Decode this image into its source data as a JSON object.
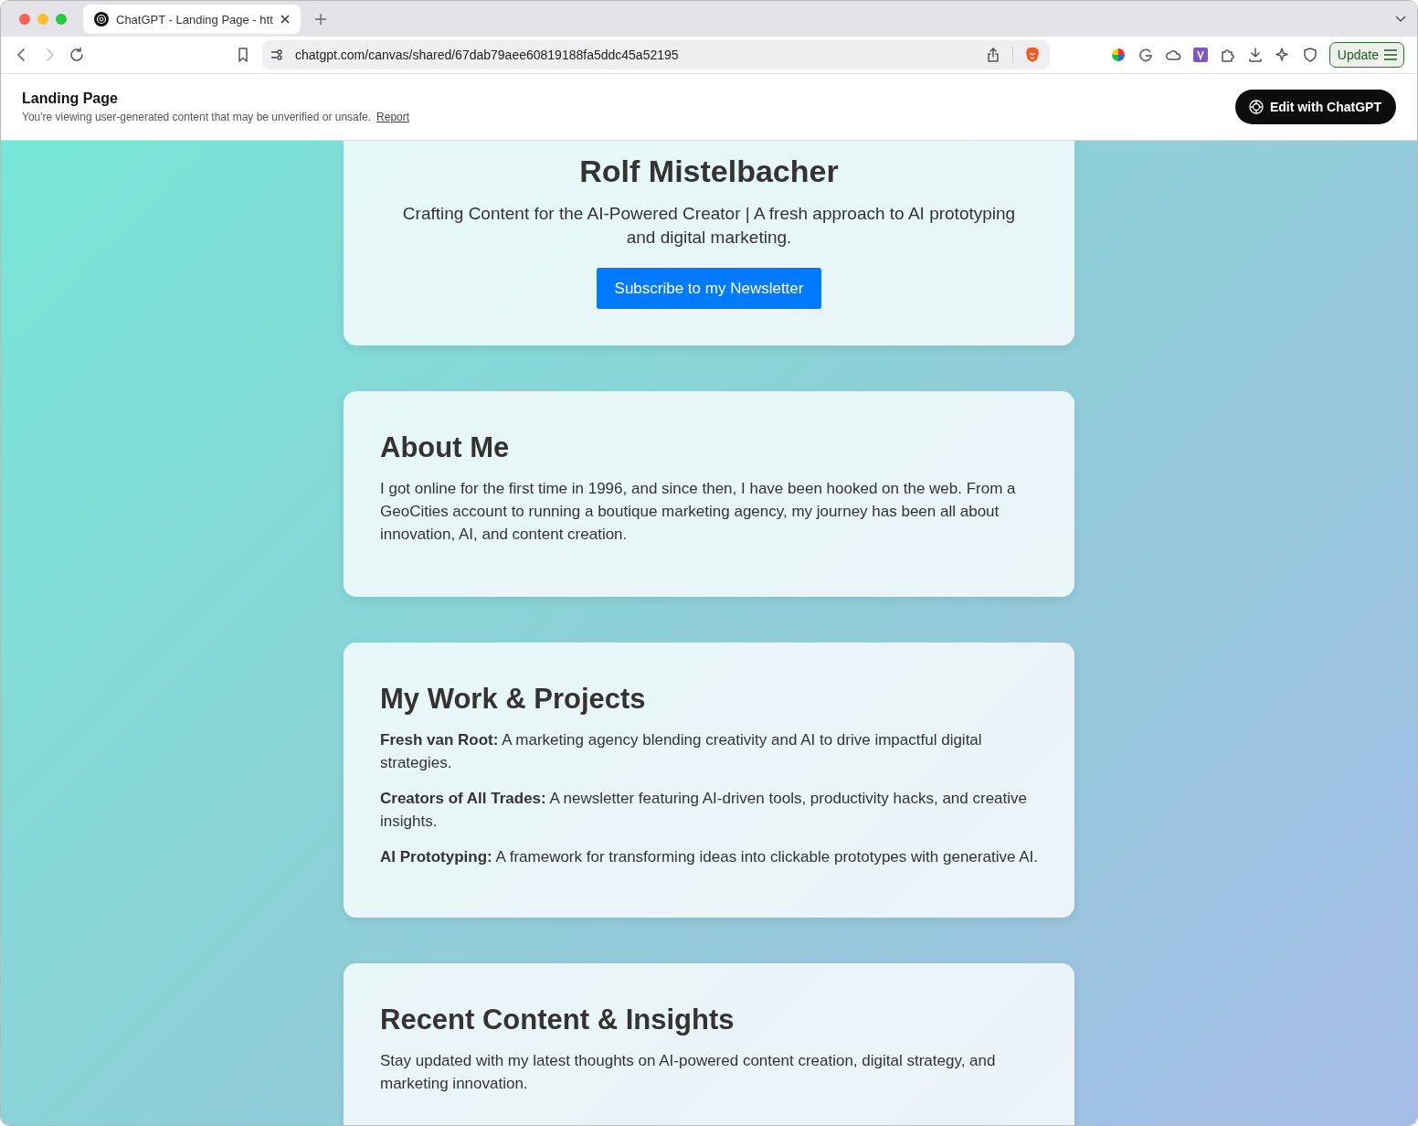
{
  "browser": {
    "tab": {
      "title": "ChatGPT - Landing Page - htt"
    },
    "address": "chatgpt.com/canvas/shared/67dab79aee60819188fa5ddc45a52195",
    "update_button": "Update"
  },
  "header": {
    "title": "Landing Page",
    "notice": "You're viewing user-generated content that may be unverified or unsafe.",
    "report_link": "Report",
    "edit_button": "Edit with ChatGPT"
  },
  "sections": [
    {
      "kind": "hero",
      "title": "Rolf Mistelbacher",
      "subtitle": "Crafting Content for the AI-Powered Creator | A fresh approach to AI prototyping and digital marketing.",
      "button": "Subscribe to my Newsletter"
    },
    {
      "kind": "text",
      "title": "About Me",
      "body": "I got online for the first time in 1996, and since then, I have been hooked on the web. From a GeoCities account to running a boutique marketing agency, my journey has been all about innovation, AI, and content creation."
    },
    {
      "kind": "list",
      "title": "My Work & Projects",
      "items": [
        "**Fresh van Root:** A marketing agency blending creativity and AI to drive impactful digital strategies.",
        "**Creators of All Trades:** A newsletter featuring AI-driven tools, productivity hacks, and creative insights.",
        "**AI Prototyping:** A framework for transforming ideas into clickable prototypes with generative AI."
      ]
    },
    {
      "kind": "text",
      "title": "Recent Content & Insights",
      "body": "Stay updated with my latest thoughts on AI-powered content creation, digital strategy, and marketing innovation."
    }
  ]
}
